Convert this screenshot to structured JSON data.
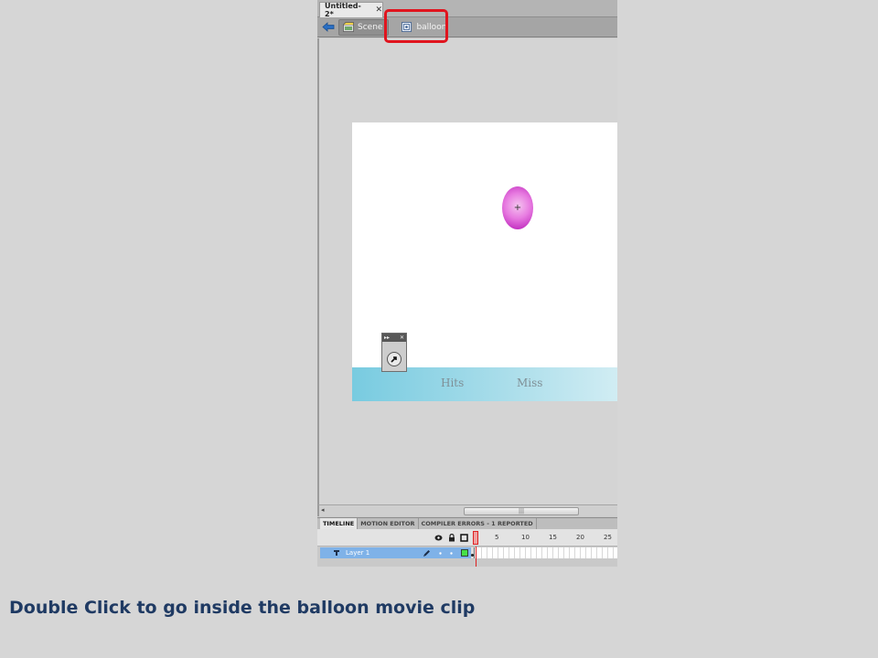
{
  "document": {
    "tab_title": "Untitled-2*",
    "close_glyph": "✕"
  },
  "editbar": {
    "scene_label": "Scene",
    "symbol_label": "balloon",
    "back_icon": "back-arrow-icon"
  },
  "stage": {
    "background": "#ffffff",
    "balloon_color": "#d64fd2",
    "registration_glyph": "+",
    "score_bar": {
      "hits_label": "Hits",
      "miss_label": "Miss"
    }
  },
  "float_panel": {
    "collapse_glyph": "▸▸",
    "close_glyph": "✕",
    "tool_icon": "selection-arrow-icon"
  },
  "scrollbar": {
    "left_glyph": "◂",
    "thumb_grip": "|||"
  },
  "timeline": {
    "tabs": [
      "TIMELINE",
      "MOTION EDITOR",
      "COMPILER ERRORS - 1 REPORTED"
    ],
    "active_tab": "TIMELINE",
    "frame_numbers": [
      "5",
      "10",
      "15",
      "20",
      "25"
    ],
    "current_frame": "1",
    "layers": [
      {
        "name": "Layer 1",
        "selected": true
      }
    ]
  },
  "annotation": {
    "highlight_color": "#e0141e"
  },
  "caption": "Double Click to go inside the balloon movie clip"
}
